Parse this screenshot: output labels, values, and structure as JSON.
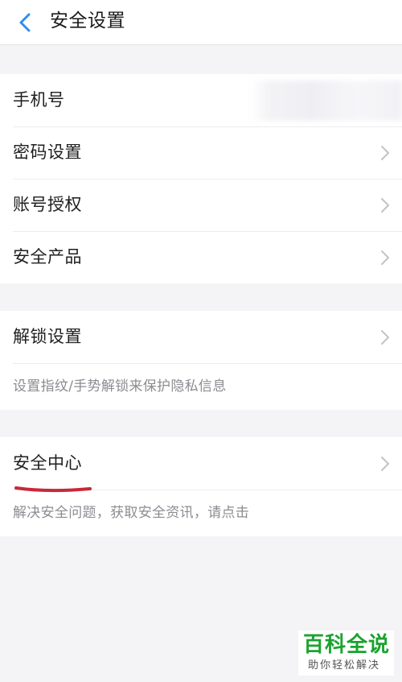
{
  "header": {
    "title": "安全设置",
    "back_icon": "chevron-left-icon",
    "accent": "#2e8ef0"
  },
  "groups": [
    {
      "items": [
        {
          "label": "手机号",
          "has_chevron": false
        },
        {
          "label": "密码设置",
          "has_chevron": true
        },
        {
          "label": "账号授权",
          "has_chevron": true
        },
        {
          "label": "安全产品",
          "has_chevron": true
        }
      ]
    },
    {
      "items": [
        {
          "label": "解锁设置",
          "has_chevron": true
        }
      ],
      "hint": "设置指纹/手势解锁来保护隐私信息"
    },
    {
      "items": [
        {
          "label": "安全中心",
          "has_chevron": true
        }
      ],
      "hint": "解决安全问题，获取安全资讯，请点击"
    }
  ],
  "annotation": {
    "underline_color": "#c8283a"
  },
  "watermark": {
    "main": "百科全说",
    "sub": "助你轻松解决",
    "color": "#1aa32f"
  }
}
